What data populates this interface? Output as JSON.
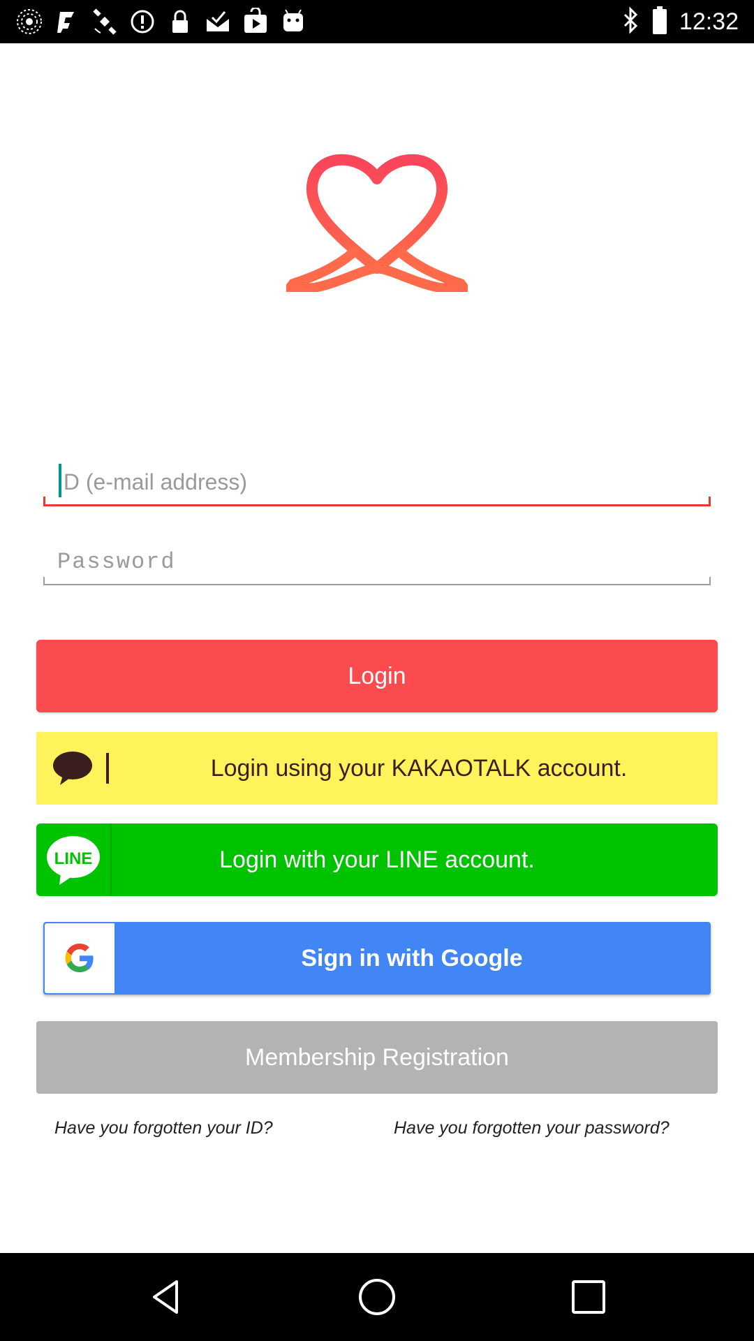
{
  "status_bar": {
    "time": "12:32",
    "icons": [
      "radar-icon",
      "fake-gps-icon",
      "satellite-icon",
      "info-icon",
      "lock-icon",
      "mail-check-icon",
      "play-store-icon",
      "android-icon"
    ],
    "right_icons": [
      "bluetooth-icon",
      "battery-icon"
    ]
  },
  "logo": {
    "name": "heart-ribbon-logo",
    "color": "#f05a5a"
  },
  "form": {
    "email_placeholder": "ID (e-mail address)",
    "email_value": "",
    "password_placeholder": "Password",
    "password_value": ""
  },
  "buttons": {
    "login": "Login",
    "kakao": "Login using your KAKAOTALK account.",
    "line": "Login with your LINE account.",
    "line_badge": "LINE",
    "google": "Sign in with Google",
    "register": "Membership Registration"
  },
  "links": {
    "forgot_id": "Have you forgotten your ID?",
    "forgot_password": "Have you forgotten your password?"
  },
  "colors": {
    "login": "#fa4b4e",
    "kakao": "#fef35b",
    "line": "#00c300",
    "google": "#4285f4",
    "register": "#b3b3b3"
  },
  "nav_bar": [
    "back-icon",
    "home-icon",
    "recents-icon"
  ]
}
